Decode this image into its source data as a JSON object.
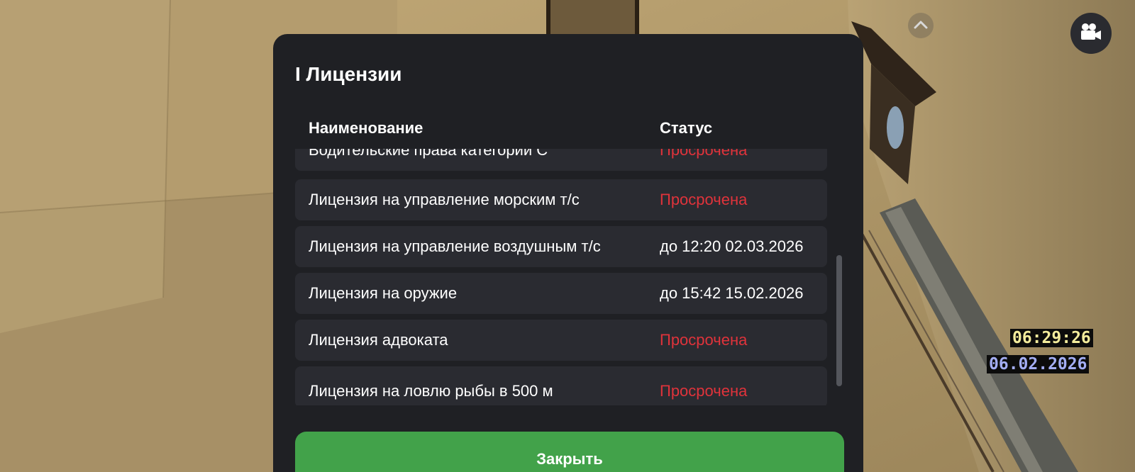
{
  "panel": {
    "title": "I Лицензии",
    "columns": {
      "name": "Наименование",
      "status": "Статус"
    },
    "licenses": [
      {
        "name": "Водительские права категории C",
        "status": "Просрочена",
        "expired": true
      },
      {
        "name": "Лицензия на управление морским т/с",
        "status": "Просрочена",
        "expired": true
      },
      {
        "name": "Лицензия на управление воздушным т/с",
        "status": "до 12:20 02.03.2026",
        "expired": false
      },
      {
        "name": "Лицензия на оружие",
        "status": "до 15:42 15.02.2026",
        "expired": false
      },
      {
        "name": "Лицензия адвоката",
        "status": "Просрочена",
        "expired": true
      },
      {
        "name": "Лицензия на ловлю рыбы в 500 м",
        "status": "Просрочена",
        "expired": true
      }
    ],
    "close_label": "Закрыть"
  },
  "hud": {
    "time": "06:29:26",
    "date": "06.02.2026"
  },
  "icons": {
    "camera": "video-camera-icon",
    "up": "chevron-up-icon"
  },
  "colors": {
    "expired": "#e0333b",
    "close_button": "#42a24a",
    "panel_bg": "#1f2024",
    "row_bg": "#2a2b31"
  }
}
